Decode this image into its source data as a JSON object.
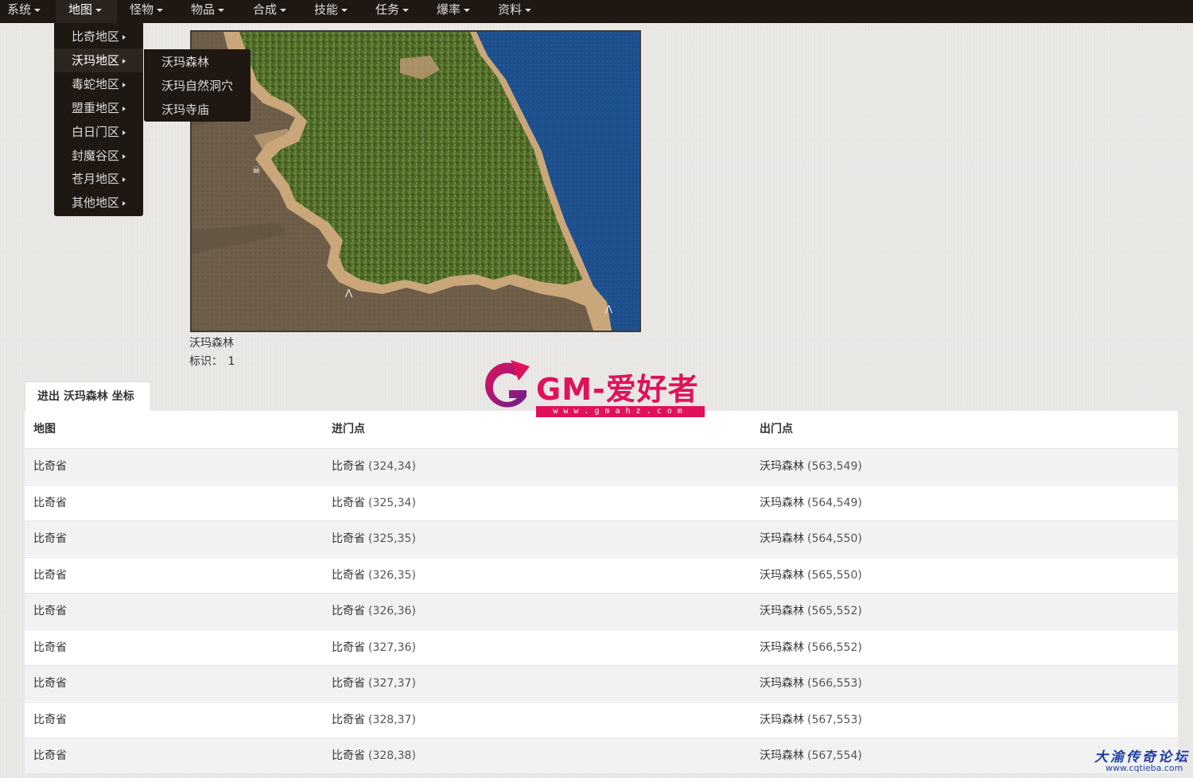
{
  "nav": {
    "items": [
      {
        "label": "系统"
      },
      {
        "label": "地图"
      },
      {
        "label": "怪物"
      },
      {
        "label": "物品"
      },
      {
        "label": "合成"
      },
      {
        "label": "技能"
      },
      {
        "label": "任务"
      },
      {
        "label": "爆率"
      },
      {
        "label": "资料"
      }
    ],
    "active_index": 1
  },
  "map_menu": {
    "items": [
      {
        "label": "比奇地区"
      },
      {
        "label": "沃玛地区"
      },
      {
        "label": "毒蛇地区"
      },
      {
        "label": "盟重地区"
      },
      {
        "label": "白日门区"
      },
      {
        "label": "封魔谷区"
      },
      {
        "label": "苍月地区"
      },
      {
        "label": "其他地区"
      }
    ],
    "active_index": 1,
    "submenu": [
      {
        "label": "沃玛森林"
      },
      {
        "label": "沃玛自然洞穴"
      },
      {
        "label": "沃玛寺庙"
      }
    ]
  },
  "map": {
    "caption": "沃玛森林",
    "id_label": "标识：",
    "id_value": "1"
  },
  "tab": {
    "label": "进出 沃玛森林 坐标"
  },
  "table": {
    "headers": [
      "地图",
      "进门点",
      "出门点"
    ],
    "rows": [
      {
        "map": "比奇省",
        "entry_map": "比奇省",
        "entry_coord": "(324,34)",
        "exit_map": "沃玛森林",
        "exit_coord": "(563,549)"
      },
      {
        "map": "比奇省",
        "entry_map": "比奇省",
        "entry_coord": "(325,34)",
        "exit_map": "沃玛森林",
        "exit_coord": "(564,549)"
      },
      {
        "map": "比奇省",
        "entry_map": "比奇省",
        "entry_coord": "(325,35)",
        "exit_map": "沃玛森林",
        "exit_coord": "(564,550)"
      },
      {
        "map": "比奇省",
        "entry_map": "比奇省",
        "entry_coord": "(326,35)",
        "exit_map": "沃玛森林",
        "exit_coord": "(565,550)"
      },
      {
        "map": "比奇省",
        "entry_map": "比奇省",
        "entry_coord": "(326,36)",
        "exit_map": "沃玛森林",
        "exit_coord": "(565,552)"
      },
      {
        "map": "比奇省",
        "entry_map": "比奇省",
        "entry_coord": "(327,36)",
        "exit_map": "沃玛森林",
        "exit_coord": "(566,552)"
      },
      {
        "map": "比奇省",
        "entry_map": "比奇省",
        "entry_coord": "(327,37)",
        "exit_map": "沃玛森林",
        "exit_coord": "(566,553)"
      },
      {
        "map": "比奇省",
        "entry_map": "比奇省",
        "entry_coord": "(328,37)",
        "exit_map": "沃玛森林",
        "exit_coord": "(567,553)"
      },
      {
        "map": "比奇省",
        "entry_map": "比奇省",
        "entry_coord": "(328,38)",
        "exit_map": "沃玛森林",
        "exit_coord": "(567,554)"
      }
    ]
  },
  "watermarks": {
    "logo_text": "GM-爱好者",
    "logo_url": "www.gmahz.com",
    "forum_title": "大渝传奇论坛",
    "forum_url": "www.cqtieba.com"
  },
  "colors": {
    "nav_bg": "#1e1712",
    "logo_accent": "#e0115a",
    "forum_blue": "#1d3da8",
    "sea": "#1d4f8c",
    "forest": "#4f6a2a",
    "sand": "#c9a77a",
    "ground": "#6e5e49"
  }
}
